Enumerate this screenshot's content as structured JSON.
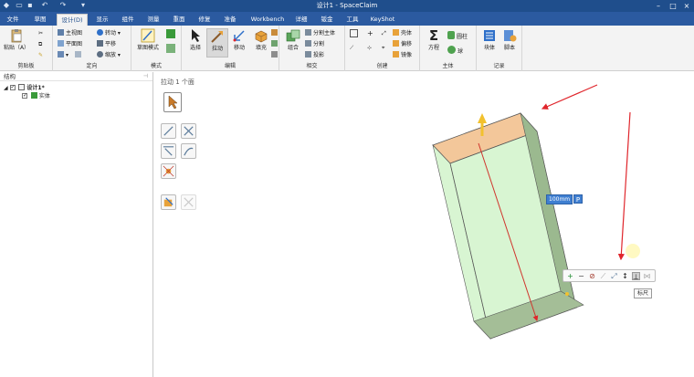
{
  "window": {
    "title": "设计1 - SpaceClaim"
  },
  "tabs": [
    {
      "label": "文件"
    },
    {
      "label": "草图"
    },
    {
      "label": "设计(D)"
    },
    {
      "label": "显示"
    },
    {
      "label": "组件"
    },
    {
      "label": "测量"
    },
    {
      "label": "重面"
    },
    {
      "label": "修复"
    },
    {
      "label": "准备"
    },
    {
      "label": "Workbench"
    },
    {
      "label": "详细"
    },
    {
      "label": "钣金"
    },
    {
      "label": "工具"
    },
    {
      "label": "KeyShot"
    }
  ],
  "ribbon": {
    "clipboard": {
      "label": "剪贴板",
      "paste": "粘贴（A）"
    },
    "orient": {
      "label": "定向",
      "home": "主视图",
      "plan": "平面图",
      "spin": "转动",
      "pan": "平移",
      "zoom": "缩放"
    },
    "mode": {
      "label": "模式",
      "sketch": "草图模式"
    },
    "edit": {
      "label": "编辑",
      "select": "选择",
      "pull": "拉动",
      "move": "移动",
      "fill": "填充"
    },
    "intersect": {
      "label": "相交",
      "combine": "组合",
      "split_body": "分割主体",
      "split": "分割",
      "project": "投影"
    },
    "create": {
      "label": "创建",
      "shell": "壳体",
      "offset": "偏移",
      "mirror": "镜像"
    },
    "body": {
      "label": "主体",
      "equation": "方程",
      "cylinder": "圆柱",
      "sphere": "球"
    },
    "record": {
      "label": "记录",
      "block": "块体",
      "script": "脚本"
    }
  },
  "structure": {
    "title": "结构",
    "root": "设计1*",
    "child": "实体"
  },
  "canvas": {
    "status": "拉动 1 个面",
    "dimension": "100mm",
    "p_badge": "P",
    "tooltip": "标尺"
  },
  "colors": {
    "box_front": "#d8f5d2",
    "box_side": "#9bb98f",
    "box_top": "#f3c79a",
    "box_bottom": "#a4be97",
    "arrow": "#e0262c",
    "accent": "#3f7fd1"
  }
}
